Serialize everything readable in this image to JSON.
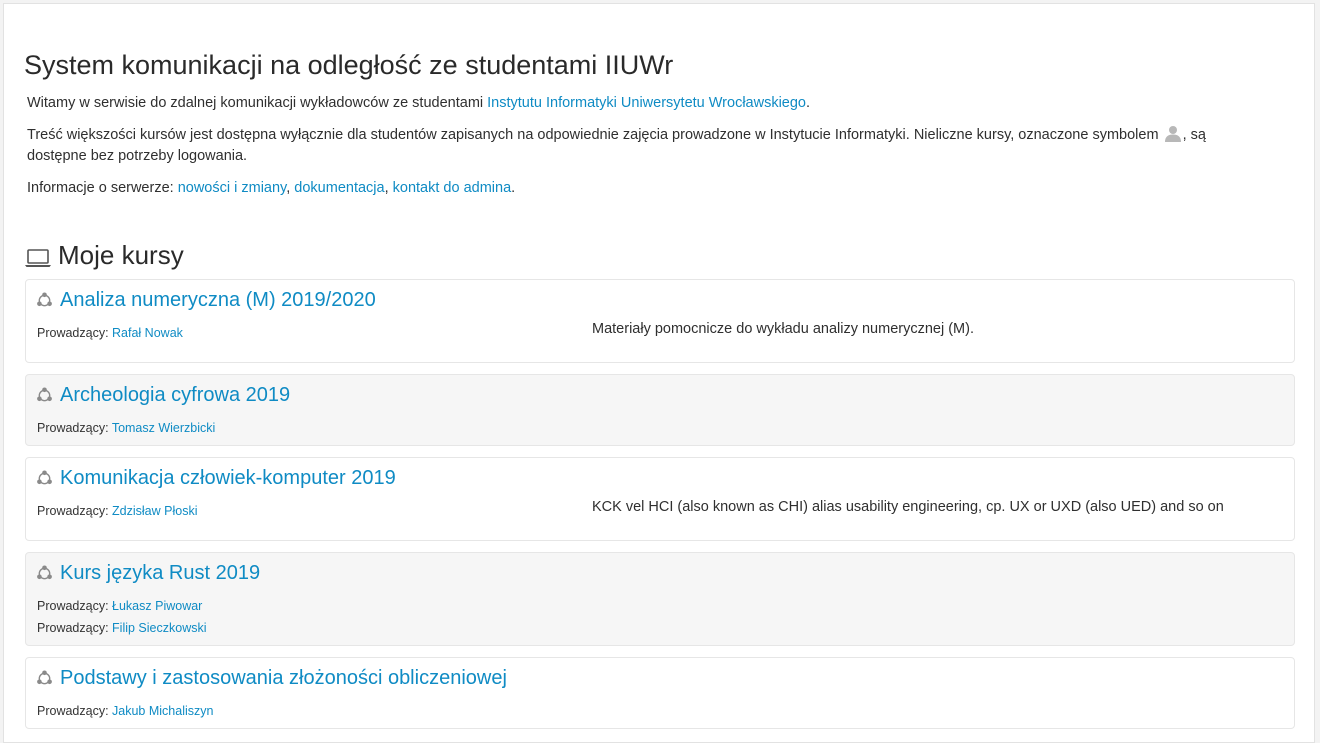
{
  "header": {
    "title": "System komunikacji na odległość ze studentami IIUWr"
  },
  "intro": {
    "welcome_text": "Witamy w serwisie do zdalnej komunikacji wykładowców ze studentami ",
    "institute_link": "Instytutu Informatyki Uniwersytetu Wrocławskiego",
    "welcome_end": ".",
    "access_text_1": "Treść większości kursów jest dostępna wyłącznie dla studentów zapisanych na odpowiednie zajęcia prowadzone w Instytucie Informatyki. Nieliczne kursy, oznaczone symbolem ",
    "access_text_2": ", są dostępne bez potrzeby logowania.",
    "guest_icon": "guest-user-icon",
    "server_info_label": "Informacje o serwerze: ",
    "news_link": "nowości i zmiany",
    "sep1": ", ",
    "docs_link": "dokumentacja",
    "sep2": ", ",
    "contact_link": "kontakt do admina",
    "end": "."
  },
  "my_courses": {
    "title": "Moje kursy",
    "icon": "laptop-icon",
    "teacher_label": "Prowadzący: ",
    "courses": [
      {
        "title": "Analiza numeryczna (M) 2019/2020",
        "teachers": [
          "Rafał Nowak"
        ],
        "description": "Materiały pomocnicze do wykładu analizy numerycznej (M)."
      },
      {
        "title": "Archeologia cyfrowa 2019",
        "teachers": [
          "Tomasz Wierzbicki"
        ],
        "description": ""
      },
      {
        "title": "Komunikacja człowiek-komputer 2019",
        "teachers": [
          "Zdzisław Płoski"
        ],
        "description": "KCK vel HCI (also known as CHI) alias usability engineering, cp. UX or UXD (also UED) and so on"
      },
      {
        "title": "Kurs języka Rust 2019",
        "teachers": [
          "Łukasz Piwowar",
          "Filip Sieczkowski"
        ],
        "description": ""
      },
      {
        "title": "Podstawy i zastosowania złożoności obliczeniowej",
        "teachers": [
          "Jakub Michaliszyn"
        ],
        "description": ""
      }
    ]
  },
  "colors": {
    "link": "#0f8bc4",
    "text": "#2f2f2f",
    "card_alt_bg": "#f6f6f6"
  }
}
